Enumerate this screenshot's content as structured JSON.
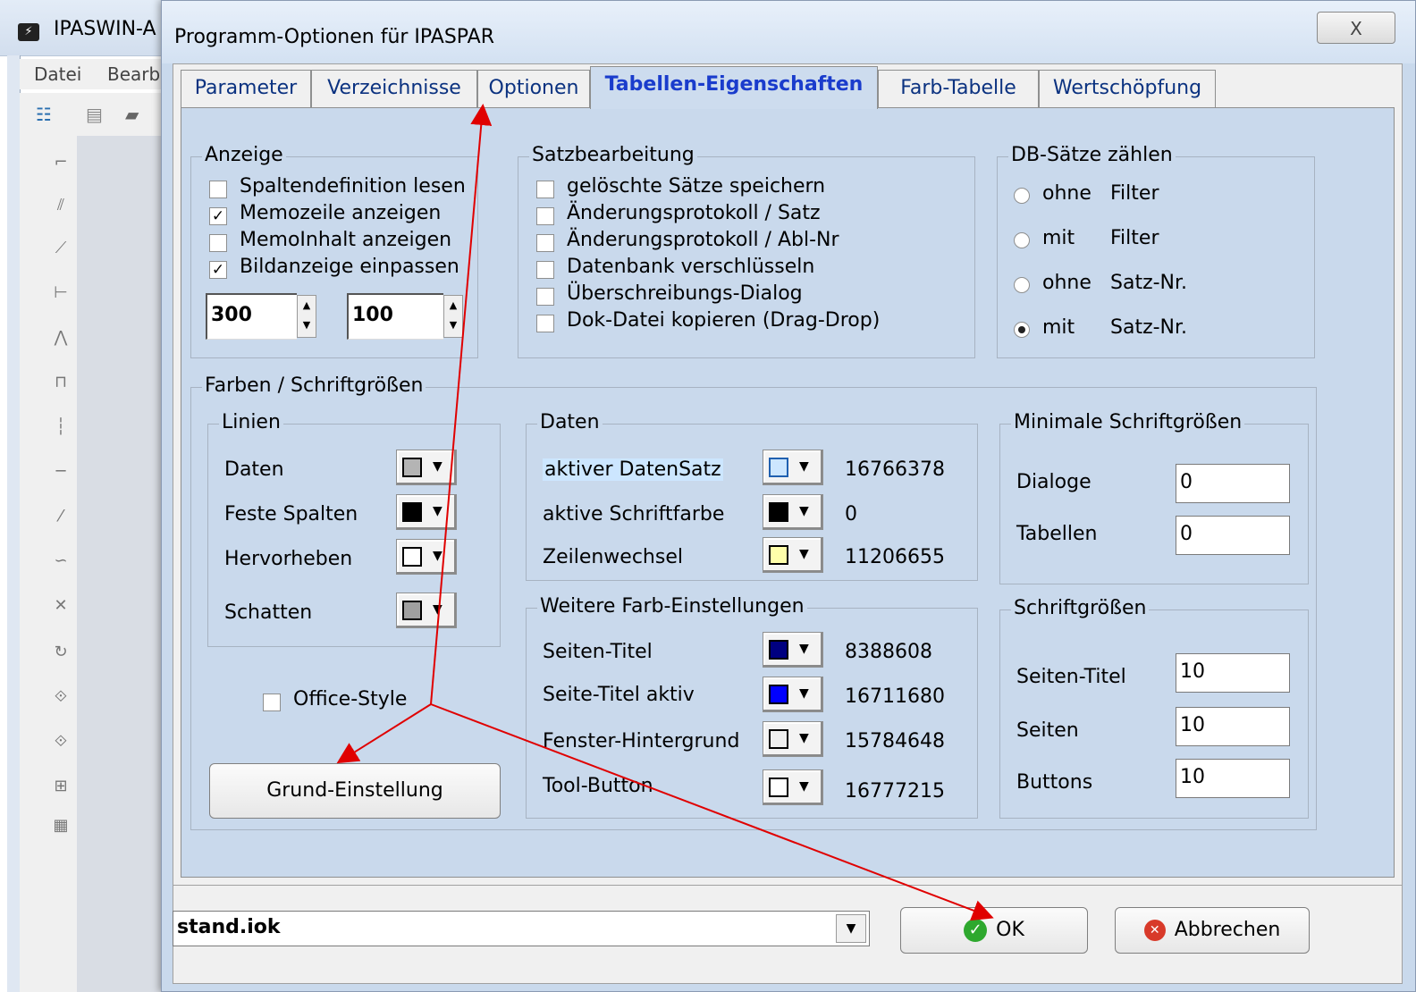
{
  "background_app": {
    "title": "IPASWIN-A",
    "menu": [
      "Datei",
      "Bearb"
    ]
  },
  "dialog": {
    "title": "Programm-Optionen für IPASPAR",
    "close_symbol": "X"
  },
  "tabs": [
    {
      "label": "Parameter",
      "active": false
    },
    {
      "label": "Verzeichnisse",
      "active": false
    },
    {
      "label": "Optionen",
      "active": false
    },
    {
      "label": "Tabellen-Eigenschaften",
      "active": true
    },
    {
      "label": "Farb-Tabelle",
      "active": false
    },
    {
      "label": "Wertschöpfung",
      "active": false
    }
  ],
  "anzeige": {
    "title": "Anzeige",
    "items": [
      {
        "label": "Spaltendefinition lesen",
        "checked": false
      },
      {
        "label": "Memozeile anzeigen",
        "checked": true
      },
      {
        "label": "MemoInhalt anzeigen",
        "checked": false
      },
      {
        "label": "Bildanzeige einpassen",
        "checked": true
      }
    ],
    "spin1_value": "300",
    "spin2_value": "100"
  },
  "satzbearbeitung": {
    "title": "Satzbearbeitung",
    "items": [
      {
        "label": "gelöschte Sätze speichern",
        "checked": false
      },
      {
        "label": "Änderungsprotokoll / Satz",
        "checked": false
      },
      {
        "label": "Änderungsprotokoll / Abl-Nr",
        "checked": false
      },
      {
        "label": "Datenbank verschlüsseln",
        "checked": false
      },
      {
        "label": "Überschreibungs-Dialog",
        "checked": false
      },
      {
        "label": "Dok-Datei kopieren (Drag-Drop)",
        "checked": false
      }
    ]
  },
  "db_saetze": {
    "title": "DB-Sätze zählen",
    "options": [
      {
        "a": "ohne",
        "b": "Filter",
        "selected": false
      },
      {
        "a": "mit",
        "b": "Filter",
        "selected": false
      },
      {
        "a": "ohne",
        "b": "Satz-Nr.",
        "selected": false
      },
      {
        "a": "mit",
        "b": "Satz-Nr.",
        "selected": true
      }
    ]
  },
  "farben": {
    "title": "Farben / Schriftgrößen",
    "linien": {
      "title": "Linien",
      "items": [
        {
          "label": "Daten",
          "color": "#b4b4b4"
        },
        {
          "label": "Feste Spalten",
          "color": "#000000"
        },
        {
          "label": "Hervorheben",
          "color": "#ffffff"
        },
        {
          "label": "Schatten",
          "color": "#a0a0a0"
        }
      ]
    },
    "daten": {
      "title": "Daten",
      "items": [
        {
          "label": "aktiver DatenSatz",
          "color": "#cce6ff",
          "value": "16766378"
        },
        {
          "label": "aktive Schriftfarbe",
          "color": "#000000",
          "value": "0"
        },
        {
          "label": "Zeilenwechsel",
          "color": "#ffffaa",
          "value": "11206655"
        }
      ]
    },
    "weitere": {
      "title": "Weitere Farb-Einstellungen",
      "items": [
        {
          "label": "Seiten-Titel",
          "color": "#000080",
          "value": "8388608"
        },
        {
          "label": "Seite-Titel aktiv",
          "color": "#0000ff",
          "value": "16711680"
        },
        {
          "label": "Fenster-Hintergrund",
          "color": "#f0f0f0",
          "value": "15784648"
        },
        {
          "label": "Tool-Button",
          "color": "#ffffff",
          "value": "16777215"
        }
      ]
    },
    "minimale": {
      "title": "Minimale Schriftgrößen",
      "items": [
        {
          "label": "Dialoge",
          "value": "0"
        },
        {
          "label": "Tabellen",
          "value": "0"
        }
      ]
    },
    "schriftgroessen": {
      "title": "Schriftgrößen",
      "items": [
        {
          "label": "Seiten-Titel",
          "value": "10"
        },
        {
          "label": "Seiten",
          "value": "10"
        },
        {
          "label": "Buttons",
          "value": "10"
        }
      ]
    },
    "office_style": {
      "label": "Office-Style",
      "checked": false
    },
    "grund_button": "Grund-Einstellung"
  },
  "footer": {
    "combo_value": "stand.iok",
    "ok_label": "OK",
    "cancel_label": "Abbrechen"
  },
  "annotation_color": "#e00000"
}
